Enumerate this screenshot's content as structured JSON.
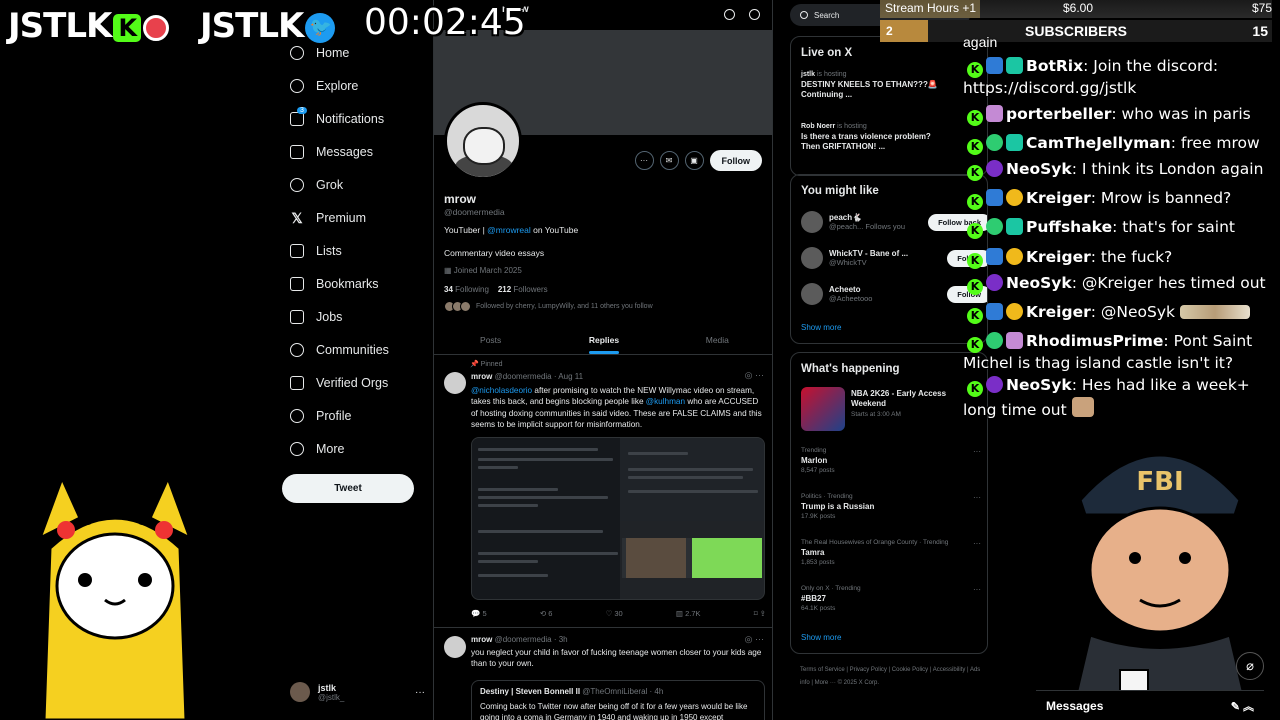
{
  "overlay": {
    "brand1": "JSTLK",
    "brand2": "JSTLK",
    "kick_glyph": "K",
    "twitter_glyph": "🐦",
    "timer": "00:02:45"
  },
  "nav": {
    "items": [
      {
        "label": "Home",
        "icon": "home-icon"
      },
      {
        "label": "Explore",
        "icon": "search-icon"
      },
      {
        "label": "Notifications",
        "icon": "bell-icon",
        "badge": "3"
      },
      {
        "label": "Messages",
        "icon": "mail-icon"
      },
      {
        "label": "Grok",
        "icon": "grok-icon"
      },
      {
        "label": "Premium",
        "icon": "x-logo-icon"
      },
      {
        "label": "Lists",
        "icon": "list-icon"
      },
      {
        "label": "Bookmarks",
        "icon": "bookmark-icon"
      },
      {
        "label": "Jobs",
        "icon": "briefcase-icon"
      },
      {
        "label": "Communities",
        "icon": "people-icon"
      },
      {
        "label": "Verified Orgs",
        "icon": "lightning-icon"
      },
      {
        "label": "Profile",
        "icon": "person-icon"
      },
      {
        "label": "More",
        "icon": "more-circle-icon"
      }
    ],
    "tweet_button": "Tweet",
    "account": {
      "name": "jstlk",
      "handle": "@jstlk_",
      "dots": "···"
    }
  },
  "profile": {
    "topbar_title": "mrow",
    "name": "mrow",
    "handle": "@doomermedia",
    "bio_prefix": "YouTuber | ",
    "bio_link": "@mrowreal",
    "bio_suffix": " on YouTube",
    "bio_line2": "Commentary video essays",
    "joined": "Joined March 2025",
    "following_count": "34",
    "following_label": " Following",
    "followers_count": "212",
    "followers_label": " Followers",
    "followed_by": "Followed by cherry, LumpyWilly, and 11 others you follow",
    "follow_button": "Follow",
    "more_glyph": "···",
    "mail_glyph": "✉",
    "sub_glyph": "▣"
  },
  "tabs": [
    "Posts",
    "Replies",
    "Media"
  ],
  "tweets": [
    {
      "pinned": "Pinned",
      "name": "mrow",
      "handle_time": "@doomermedia · Aug 11",
      "link1": "@nicholasdeorio",
      "text1": " after promising to watch the NEW Willymac video on stream, takes this back, and begins blocking people like ",
      "link2": "@kulhman",
      "text2": " who are ACCUSED of hosting doxing communities in said video. These are FALSE CLAIMS and this seems to be implicit support for misinformation.",
      "replies": "5",
      "retweets": "6",
      "likes": "30",
      "views": "2.7K"
    },
    {
      "name": "mrow",
      "handle_time": "@doomermedia · 3h",
      "text": "you neglect your child in favor of fucking teenage women closer to your kids age than to your own.",
      "quote_name": "Destiny | Steven Bonnell II",
      "quote_handle": "@TheOmniLiberal · 4h",
      "quote_text": "Coming back to Twitter now after being off of it for a few years would be like going into a coma in Germany in 1940 and waking up in 1950 except"
    }
  ],
  "right": {
    "search_placeholder": "Search",
    "live_title": "Live on X",
    "live": [
      {
        "who": "jstlk",
        "status": " is hosting",
        "text": "DESTINY KNEELS TO ETHAN???🚨 Continuing ..."
      },
      {
        "who": "Rob Noerr",
        "status": " is hosting",
        "text": "Is there a trans violence problem? Then GRIFTATHON! ..."
      }
    ],
    "wtf_title": "You might like",
    "wtf": [
      {
        "name": "peach🐇",
        "handle": "@peach...",
        "extra": "Follows you",
        "button": "Follow back"
      },
      {
        "name": "WhickTV - Bane of ...",
        "handle": "@WhickTV",
        "button": "Follow"
      },
      {
        "name": "Acheeto",
        "handle": "@Acheetooo",
        "button": "Follow"
      }
    ],
    "show_more": "Show more",
    "happening_title": "What's happening",
    "event": {
      "title": "NBA 2K26 - Early Access Weekend",
      "time": "Starts at 3:00 AM"
    },
    "trends": [
      {
        "cat": "Trending",
        "title": "Marlon",
        "count": "8,547 posts"
      },
      {
        "cat": "Politics · Trending",
        "title": "Trump is a Russian",
        "count": "17.9K posts"
      },
      {
        "cat": "The Real Housewives of Orange County · Trending",
        "title": "Tamra",
        "count": "1,853 posts"
      },
      {
        "cat": "Only on X · Trending",
        "title": "#BB27",
        "count": "64.1K posts"
      }
    ],
    "footer": "Terms of Service  |  Privacy Policy  |  Cookie Policy  |  Accessibility  |  Ads info  |  More ···  © 2025 X Corp."
  },
  "stream": {
    "hours_label": "Stream Hours +1",
    "amount_mid": "$6.00",
    "amount_end": "$75",
    "gold_num": "2",
    "subs_label": "SUBSCRIBERS",
    "subs_count": "15",
    "chat_again": "again",
    "chat": [
      {
        "user": "BotRix",
        "text": " Join the discord: https://discord.gg/jstlk"
      },
      {
        "user": "porterbeller",
        "text": " who was in paris"
      },
      {
        "user": "CamTheJellyman",
        "text": " free mrow"
      },
      {
        "user": "NeoSyk",
        "text": " I think its London again"
      },
      {
        "user": "Kreiger",
        "text": " Mrow is banned?"
      },
      {
        "user": "Puffshake",
        "text": " that's for saint"
      },
      {
        "user": "Kreiger",
        "text": " the fuck?"
      },
      {
        "user": "NeoSyk",
        "text": " @Kreiger hes timed out"
      },
      {
        "user": "Kreiger",
        "text": " @NeoSyk"
      },
      {
        "user": "RhodimusPrime",
        "text": " Pont Saint Michel is thag island castle isn't it?"
      },
      {
        "user": "NeoSyk",
        "text": " Hes had like a week+ long time out"
      }
    ],
    "fbi_text": "FBI",
    "messages_label": "Messages"
  }
}
